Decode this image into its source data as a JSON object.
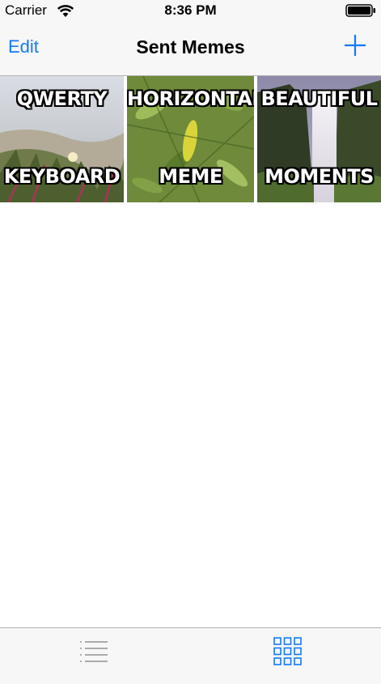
{
  "status_bar": {
    "carrier": "Carrier",
    "time": "8:36 PM",
    "icons": [
      "wifi-icon",
      "battery-icon"
    ]
  },
  "nav_bar": {
    "edit_label": "Edit",
    "title": "Sent Memes",
    "add_icon": "plus-icon"
  },
  "memes": [
    {
      "top_text": "QWERTY",
      "bottom_text": "KEYBOARD",
      "image": "grassy-dunes-flower"
    },
    {
      "top_text": "HORIZONTAL",
      "bottom_text": "MEME",
      "image": "green-leaves"
    },
    {
      "top_text": "BEAUTIFUL",
      "bottom_text": "MOMENTS",
      "image": "waterfall"
    }
  ],
  "tab_bar": {
    "tabs": [
      {
        "icon": "list-icon",
        "selected": false
      },
      {
        "icon": "grid-icon",
        "selected": true
      }
    ]
  },
  "colors": {
    "tint": "#1479f6",
    "inactive_tab": "#929292",
    "bar_background": "#f7f7f7"
  }
}
